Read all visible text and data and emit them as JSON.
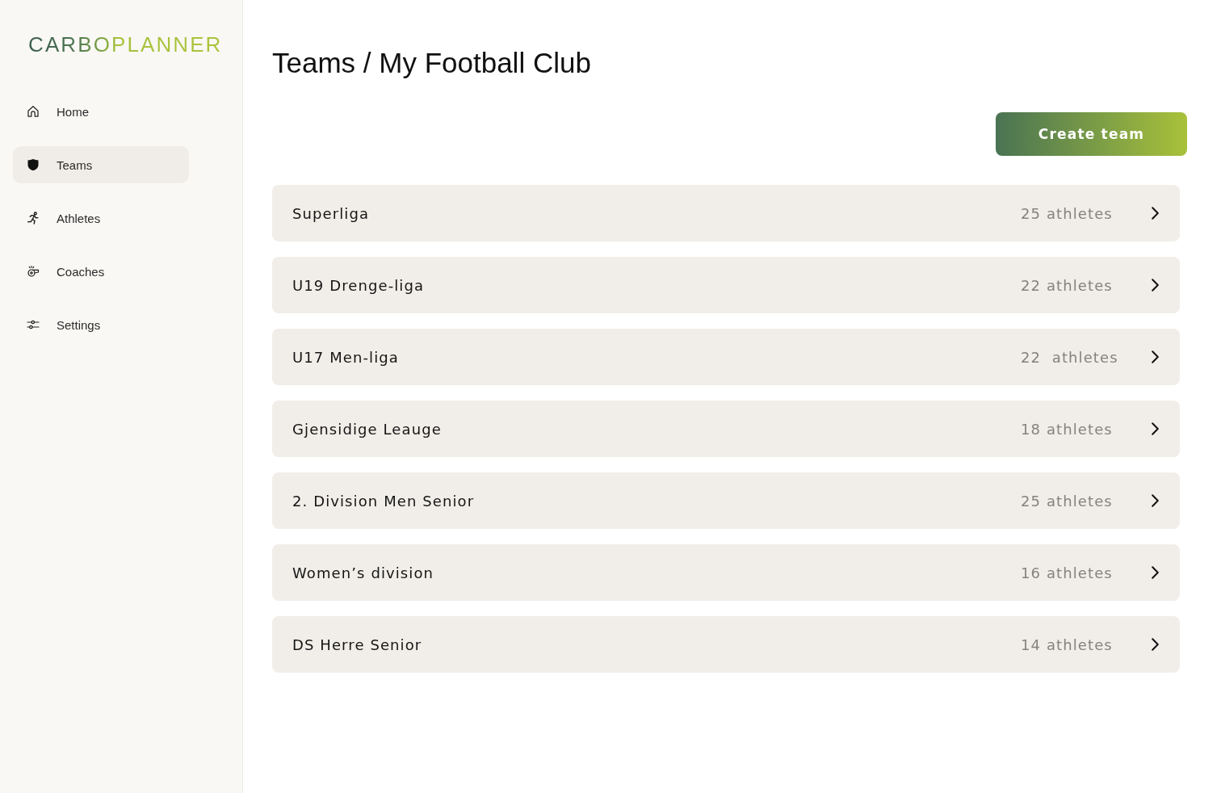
{
  "sidebar": {
    "logo": "CARBOPLANNER",
    "items": [
      {
        "kind": "home",
        "label": "Home",
        "selected": false
      },
      {
        "kind": "teams",
        "label": "Teams",
        "selected": true
      },
      {
        "kind": "athletes",
        "label": "Athletes",
        "selected": false
      },
      {
        "kind": "coaches",
        "label": "Coaches",
        "selected": false
      },
      {
        "kind": "settings",
        "label": "Settings",
        "selected": false
      }
    ]
  },
  "page": {
    "title": "Teams / My Football Club",
    "create_button": "Create team"
  },
  "teams": [
    {
      "name": "Superliga",
      "count": "25 athletes"
    },
    {
      "name": "U19 Drenge-liga",
      "count": "22 athletes"
    },
    {
      "name": "U17 Men-liga",
      "count": "22  athletes"
    },
    {
      "name": "Gjensidige Leauge",
      "count": "18 athletes"
    },
    {
      "name": "2. Division Men Senior",
      "count": "25 athletes"
    },
    {
      "name": "Women’s division",
      "count": "16 athletes"
    },
    {
      "name": "DS Herre Senior",
      "count": "14 athletes"
    }
  ]
}
